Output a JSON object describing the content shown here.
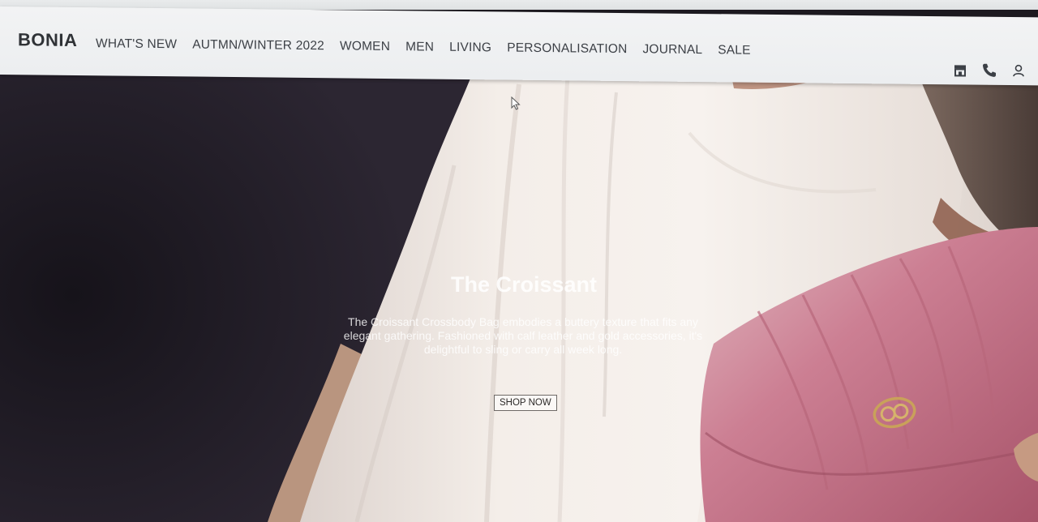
{
  "brand": {
    "logo": "BONIA"
  },
  "nav": {
    "items": [
      {
        "label": "WHAT'S NEW"
      },
      {
        "label": "AUTMN/WINTER 2022"
      },
      {
        "label": "WOMEN"
      },
      {
        "label": "MEN"
      },
      {
        "label": "LIVING"
      },
      {
        "label": "PERSONALISATION"
      },
      {
        "label": "JOURNAL"
      },
      {
        "label": "SALE"
      }
    ]
  },
  "header_icons": [
    "store-icon",
    "phone-icon",
    "account-icon"
  ],
  "hero": {
    "title": "The Croissant",
    "description": "The Croissant Crossbody Bag embodies a buttery texture that fits any elegant gathering. Fashioned with calf leather and gold accessories, it's delightful to sling or carry all week long.",
    "cta_label": "SHOP NOW"
  },
  "colors": {
    "header_bg": "#eceef0",
    "text_dark": "#2f3236",
    "hero_dark": "#1b1820",
    "fabric": "#f2ebe6",
    "bag_pink": "#c9758a"
  }
}
